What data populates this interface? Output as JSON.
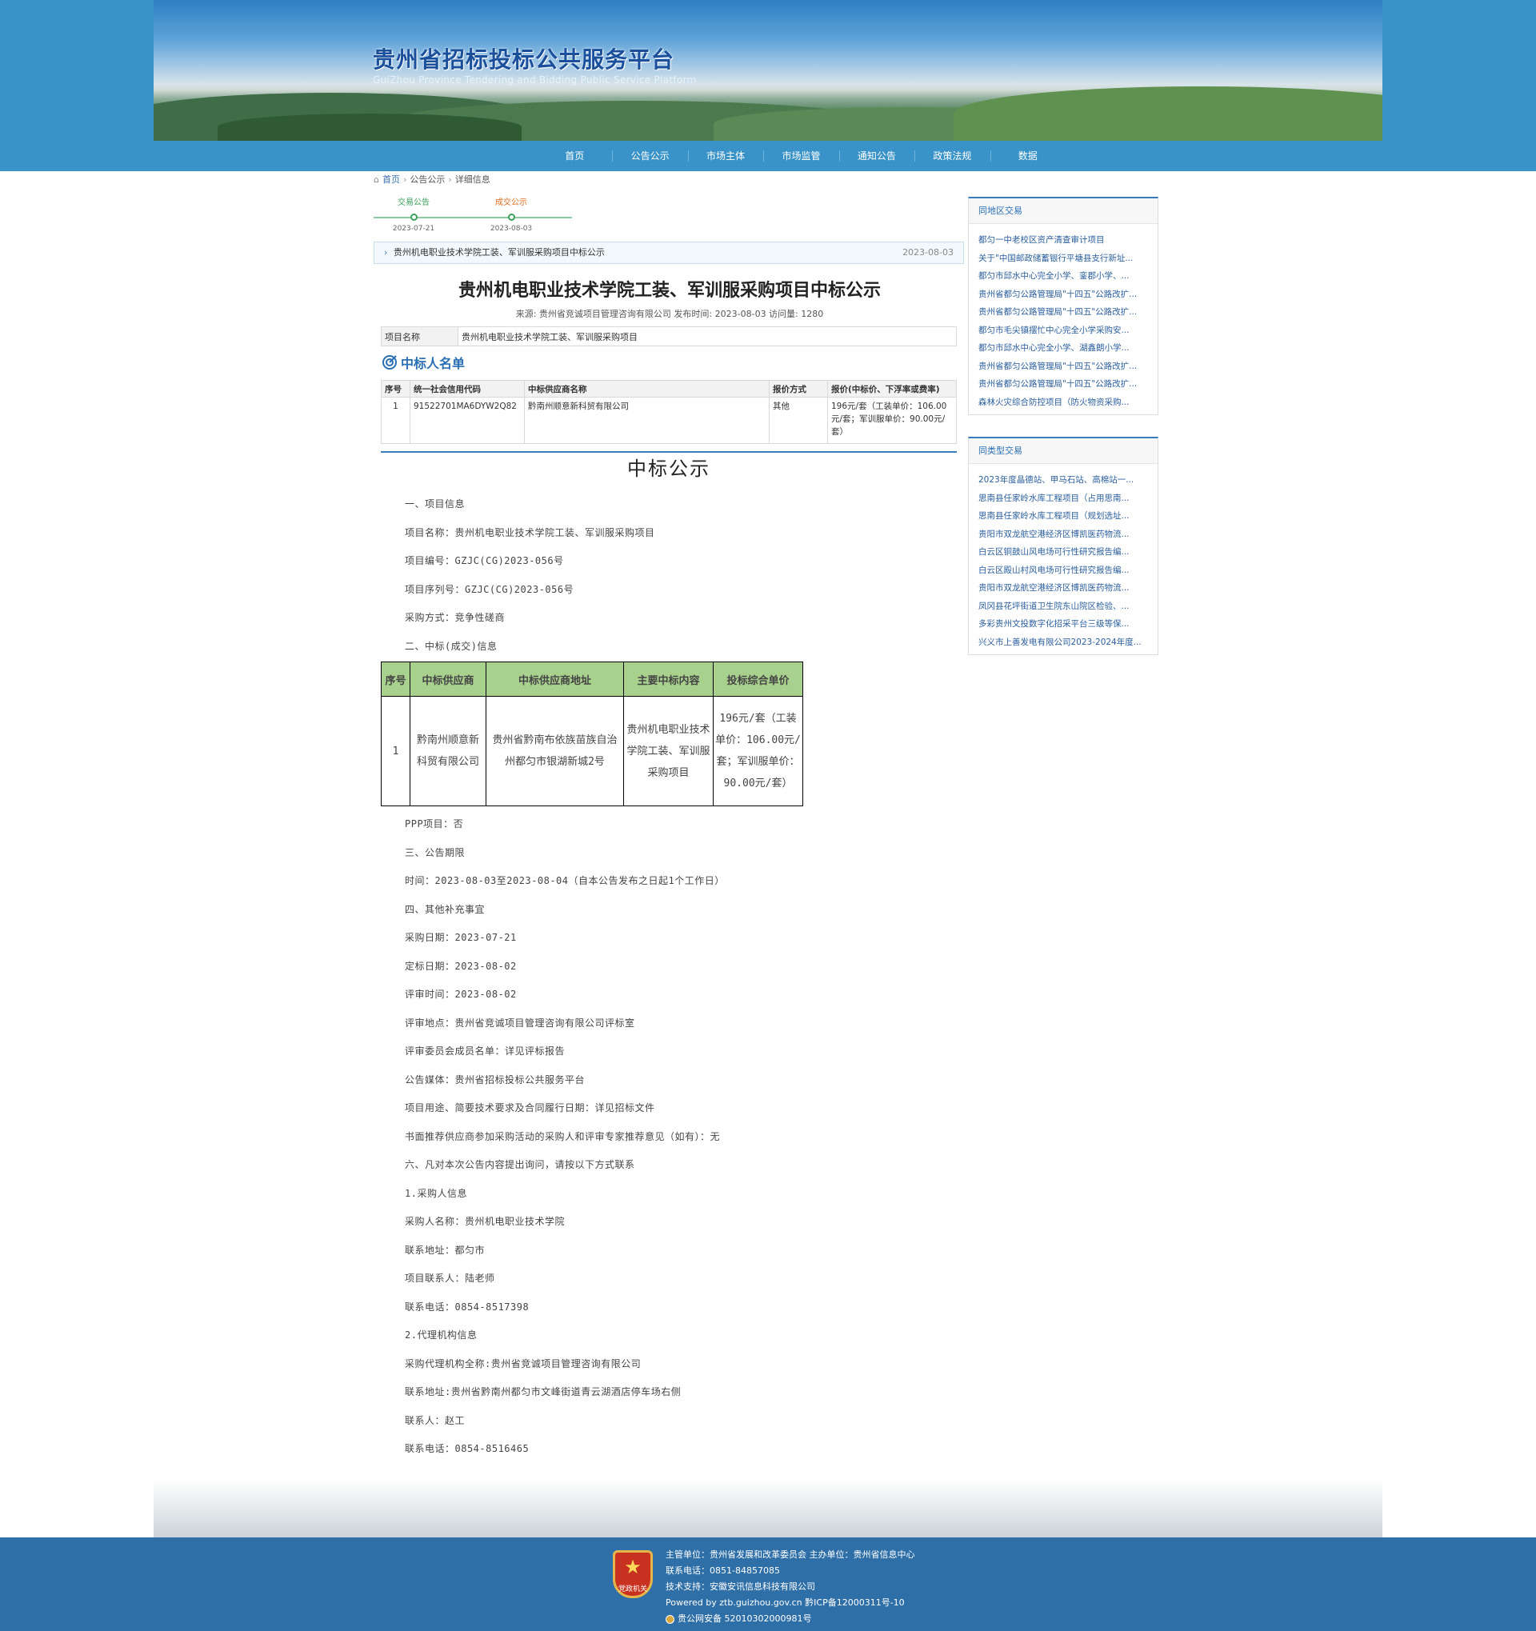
{
  "header": {
    "site_title": "贵州省招标投标公共服务平台",
    "site_subtitle": "GuiZhou Province Tendering and Bidding Public Service Platform"
  },
  "nav": [
    "首页",
    "公告公示",
    "市场主体",
    "市场监管",
    "通知公告",
    "政策法规",
    "数据"
  ],
  "breadcrumb": {
    "home": "首页",
    "level2": "公告公示",
    "level3": "详细信息"
  },
  "timeline": [
    {
      "label": "交易公告",
      "date": "2023-07-21",
      "color": "#3aa05a"
    },
    {
      "label": "成交公示",
      "date": "2023-08-03",
      "color": "#e06d1d"
    }
  ],
  "notice_bar": {
    "title": "贵州机电职业技术学院工装、军训服采购项目中标公示",
    "date": "2023-08-03"
  },
  "document": {
    "title": "贵州机电职业技术学院工装、军训服采购项目中标公示",
    "meta": "来源: 贵州省竞诚项目管理咨询有限公司   发布时间: 2023-08-03   访问量: 1280",
    "project_name_label": "项目名称",
    "project_name": "贵州机电职业技术学院工装、军训服采购项目"
  },
  "winner_list": {
    "heading": "中标人名单",
    "headers": [
      "序号",
      "统一社会信用代码",
      "中标供应商名称",
      "报价方式",
      "报价(中标价、下浮率或费率)"
    ],
    "rows": [
      [
        "1",
        "91522701MA6DYW2Q82",
        "黔南州顺意新科贸有限公司",
        "其他",
        "196元/套（工装单价：106.00元/套；军训服单价：90.00元/套）"
      ]
    ]
  },
  "content": {
    "title": "中标公示",
    "paras_before": [
      "一、项目信息",
      "项目名称：贵州机电职业技术学院工装、军训服采购项目",
      "项目编号：GZJC(CG)2023-056号",
      "项目序列号：GZJC(CG)2023-056号",
      "采购方式：竞争性磋商",
      "二、中标(成交)信息"
    ],
    "table_headers": [
      "序号",
      "中标供应商",
      "中标供应商地址",
      "主要中标内容",
      "投标综合单价"
    ],
    "table_row": [
      "1",
      "黔南州顺意新科贸有限公司",
      "贵州省黔南布依族苗族自治州都匀市银湖新城2号",
      "贵州机电职业技术学院工装、军训服采购项目",
      "196元/套（工装单价：106.00元/套；军训服单价：90.00元/套）"
    ],
    "paras_after": [
      "PPP项目：否",
      "三、公告期限",
      "时间：2023-08-03至2023-08-04（自本公告发布之日起1个工作日）",
      "四、其他补充事宜",
      "采购日期：2023-07-21",
      "定标日期：2023-08-02",
      "评审时间：2023-08-02",
      "评审地点：贵州省竞诚项目管理咨询有限公司评标室",
      "评审委员会成员名单：详见评标报告",
      "公告媒体：贵州省招标投标公共服务平台",
      "项目用途、简要技术要求及合同履行日期：详见招标文件",
      "书面推荐供应商参加采购活动的采购人和评审专家推荐意见（如有）：无",
      "六、凡对本次公告内容提出询问，请按以下方式联系",
      "1.采购人信息",
      "采购人名称：贵州机电职业技术学院",
      "联系地址：都匀市",
      "项目联系人：陆老师",
      "联系电话：0854-8517398",
      "2.代理机构信息",
      "采购代理机构全称:贵州省竞诚项目管理咨询有限公司",
      "联系地址:贵州省黔南州都匀市文峰街道青云湖酒店停车场右侧",
      "联系人：赵工",
      "联系电话：0854-8516465"
    ]
  },
  "sidebar": {
    "same_region": {
      "title": "同地区交易",
      "items": [
        "都匀一中老校区资产清查审计项目",
        "关于\"中国邮政储蓄银行平塘县支行新址...",
        "都匀市邱水中心完全小学、銮郡小学、...",
        "贵州省都匀公路管理局\"十四五\"公路改扩...",
        "贵州省都匀公路管理局\"十四五\"公路改扩...",
        "都匀市毛尖镇摆忙中心完全小学采购安...",
        "都匀市邱水中心完全小学、湖鑫朗小学...",
        "贵州省都匀公路管理局\"十四五\"公路改扩...",
        "贵州省都匀公路管理局\"十四五\"公路改扩...",
        "森林火灾综合防控项目（防火物资采购..."
      ]
    },
    "same_type": {
      "title": "同类型交易",
      "items": [
        "2023年度晶德站、甲马石站、高棉站一...",
        "思南县任家岭水库工程项目（占用思南...",
        "思南县任家岭水库工程项目（规划选址...",
        "贵阳市双龙航空港经济区博凯医药物流...",
        "白云区铜鼓山风电场可行性研究报告编...",
        "白云区殿山村风电场可行性研究报告编...",
        "贵阳市双龙航空港经济区博凯医药物流...",
        "凤冈县花坪街道卫生院东山院区检验、...",
        "多彩贵州文投数字化招采平台三级等保...",
        "兴义市上善发电有限公司2023-2024年度..."
      ]
    }
  },
  "footer": {
    "badge_text": "党政机关",
    "line1": "主管单位：贵州省发展和改革委员会   主办单位：贵州省信息中心",
    "line2": "联系电话：0851-84857085",
    "line3": "技术支持：安徽安讯信息科技有限公司",
    "line4": "Powered by ztb.guizhou.gov.cn   黔ICP备12000311号-10",
    "line5": "贵公网安备 52010302000981号"
  }
}
